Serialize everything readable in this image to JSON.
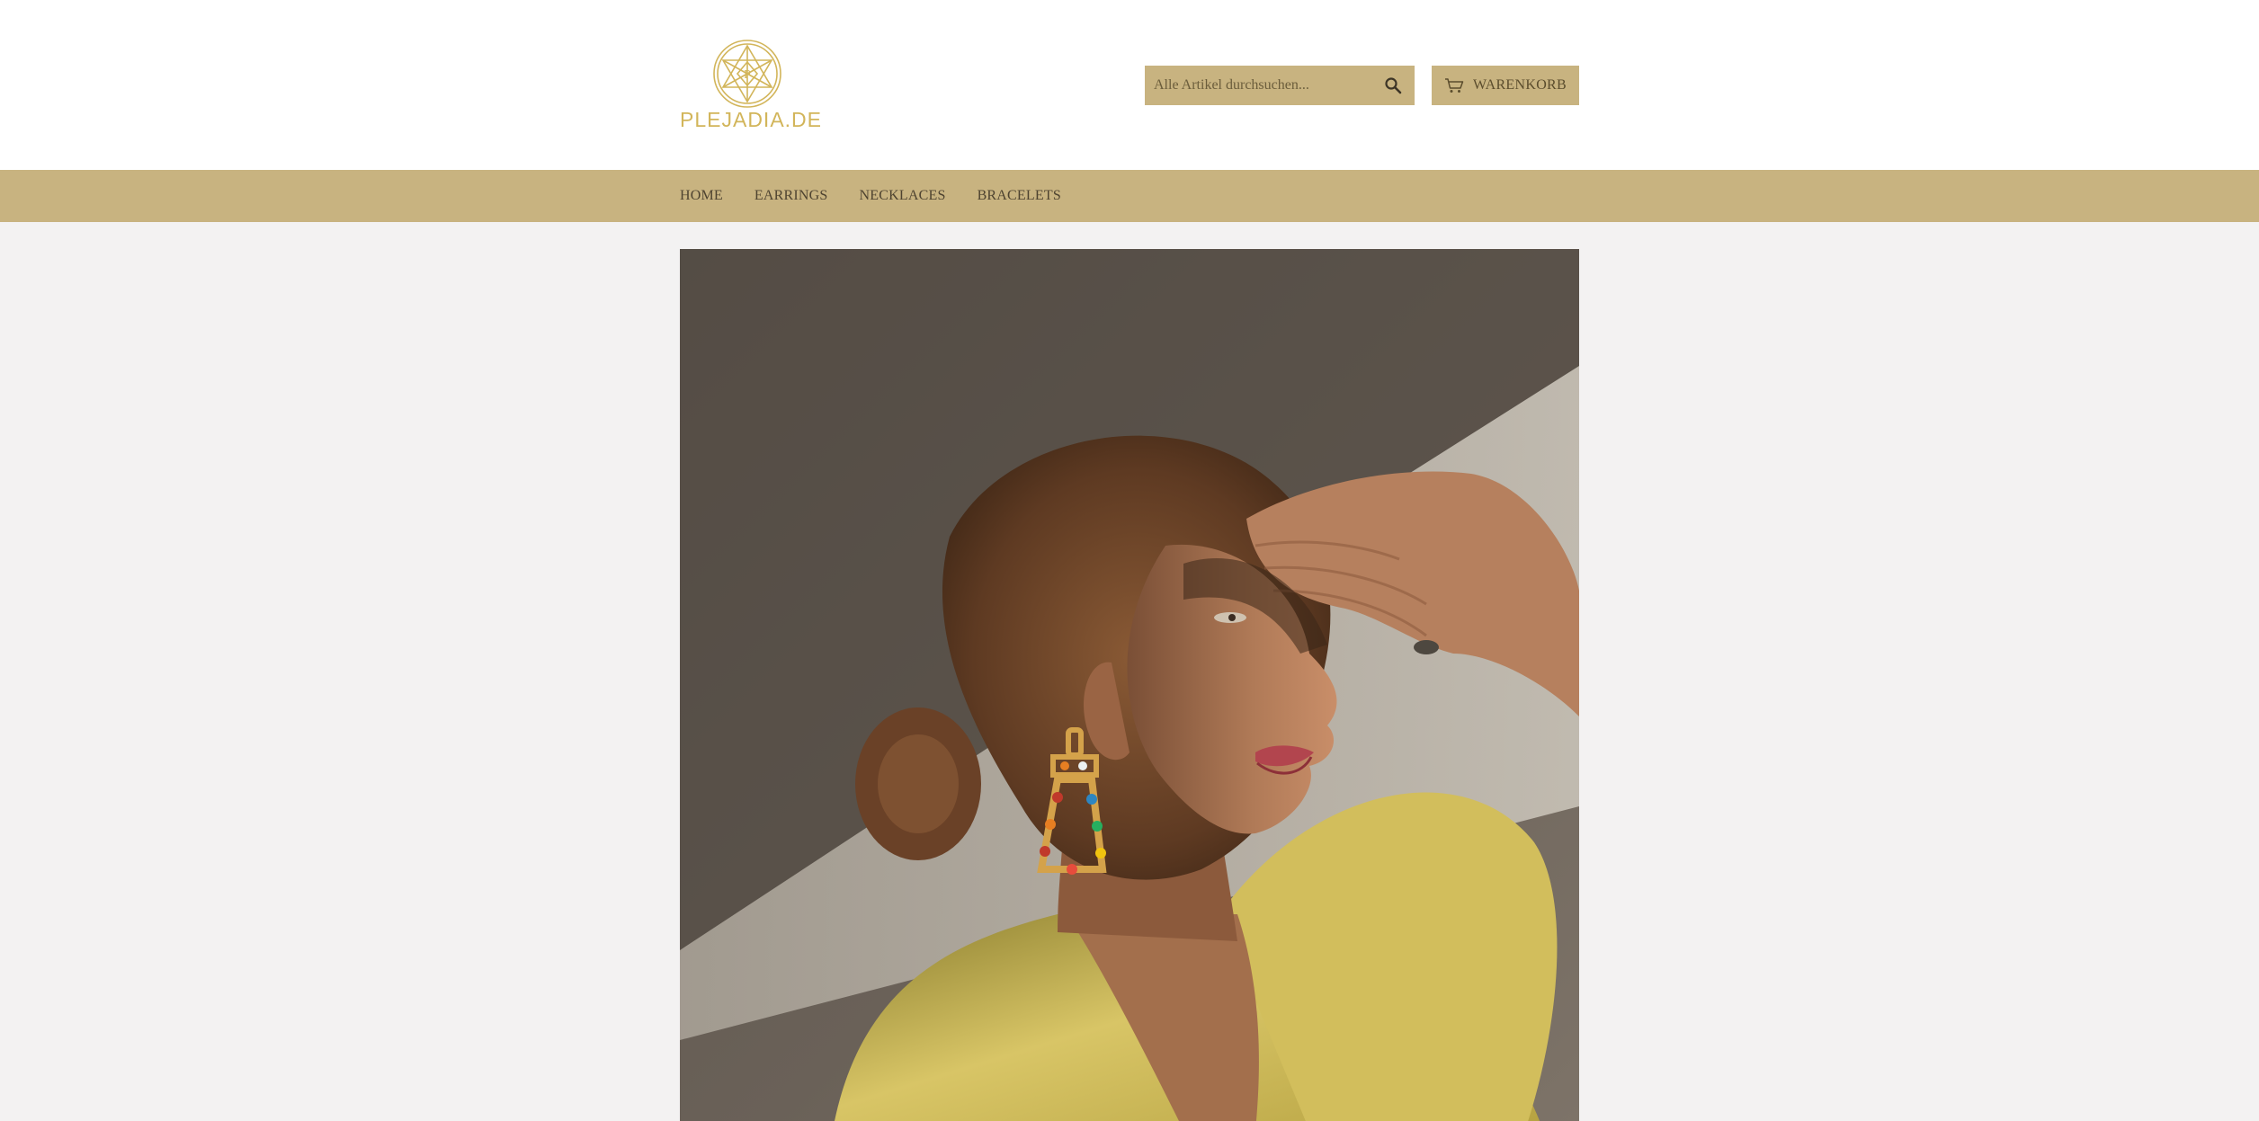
{
  "header": {
    "logo_text": "PLEJADIA.DE",
    "logo_icon": "star-of-david-emblem-icon",
    "search": {
      "placeholder": "Alle Artikel durchsuchen...",
      "value": "",
      "icon": "search-icon"
    },
    "cart": {
      "label": "WARENKORB",
      "icon": "shopping-cart-icon"
    }
  },
  "nav": {
    "items": [
      {
        "label": "HOME"
      },
      {
        "label": "EARRINGS"
      },
      {
        "label": "NECKLACES"
      },
      {
        "label": "BRACELETS"
      }
    ]
  },
  "colors": {
    "brand_gold": "#d2b55a",
    "accent_tan": "#c8b380",
    "page_background": "#f3f2f2",
    "header_background": "#ffffff"
  }
}
